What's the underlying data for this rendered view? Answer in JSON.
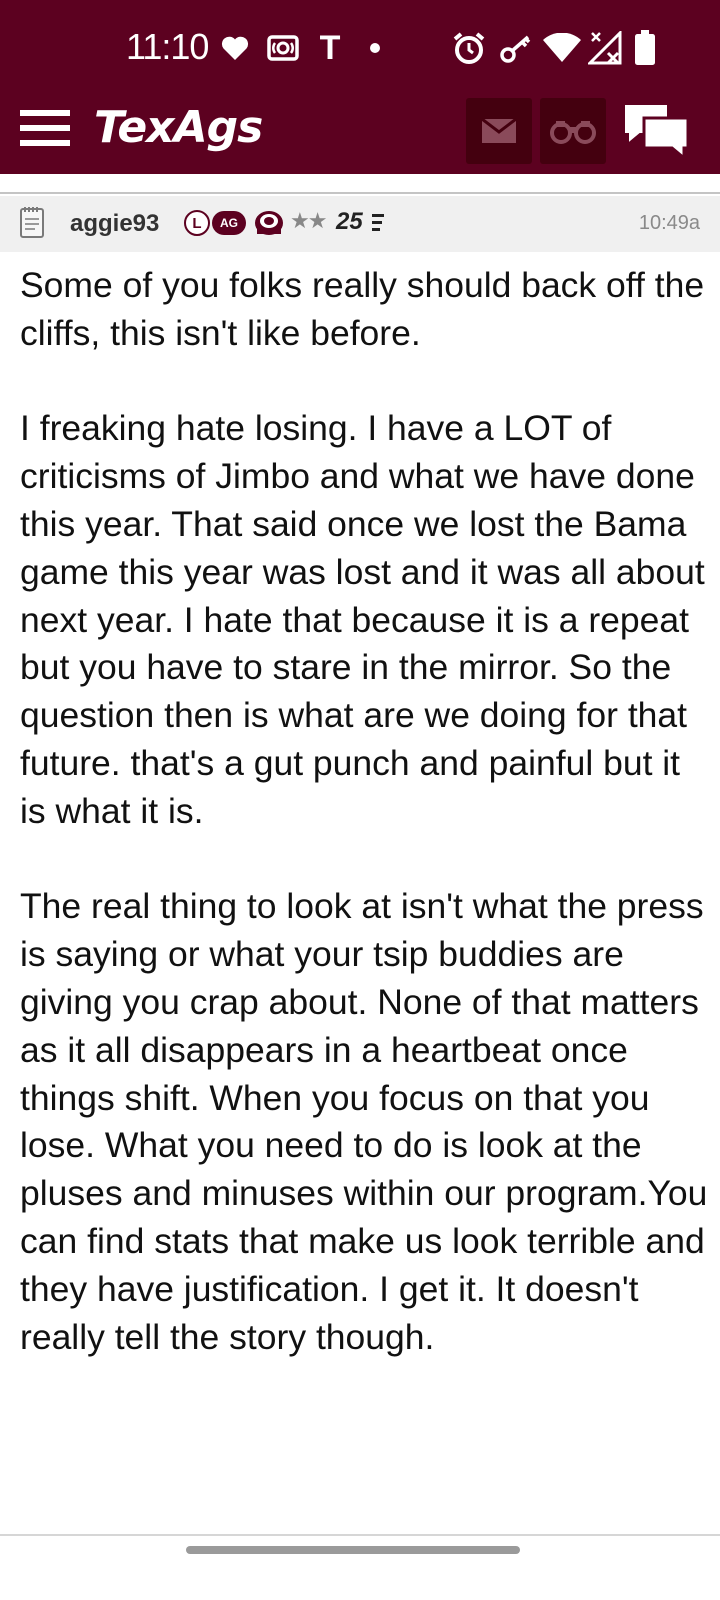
{
  "status_bar": {
    "time": "11:10",
    "icons": [
      "heart-icon",
      "radio-icon",
      "t-mobile-icon",
      "dot-icon",
      "alarm-icon",
      "key-icon",
      "wifi-icon",
      "signal-icon",
      "battery-icon"
    ],
    "t_label": "T"
  },
  "app_bar": {
    "logo": "TexAgs",
    "buttons": [
      "hamburger-menu-icon",
      "mail-icon",
      "binoculars-icon",
      "chat-icon"
    ],
    "brand_color": "#5c0120"
  },
  "post": {
    "username": "aggie93",
    "badge_l": "L",
    "badge_ag": "AG",
    "stars": "★★",
    "post_count": "25",
    "time": "10:49a",
    "paragraphs": [
      "Some of you folks really should back off the cliffs, this isn't like before.",
      "I freaking hate losing. I have a LOT of criticisms of Jimbo and what we have done this year. That said once we lost the Bama game this year was lost and it was all about next year. I hate that because it is a repeat but you have to stare in the mirror. So the question then is what are we doing for that future. that's a gut punch and painful but it is what it is.",
      "The real thing to look at isn't what the press is saying or what your tsip buddies are giving you crap about. None of that matters as it all disappears in a heartbeat once things shift. When you focus on that you lose. What you need to do is look at the pluses and minuses within our program.You can find stats that make us look terrible and they have justification. I get it. It doesn't really tell the story though."
    ]
  }
}
